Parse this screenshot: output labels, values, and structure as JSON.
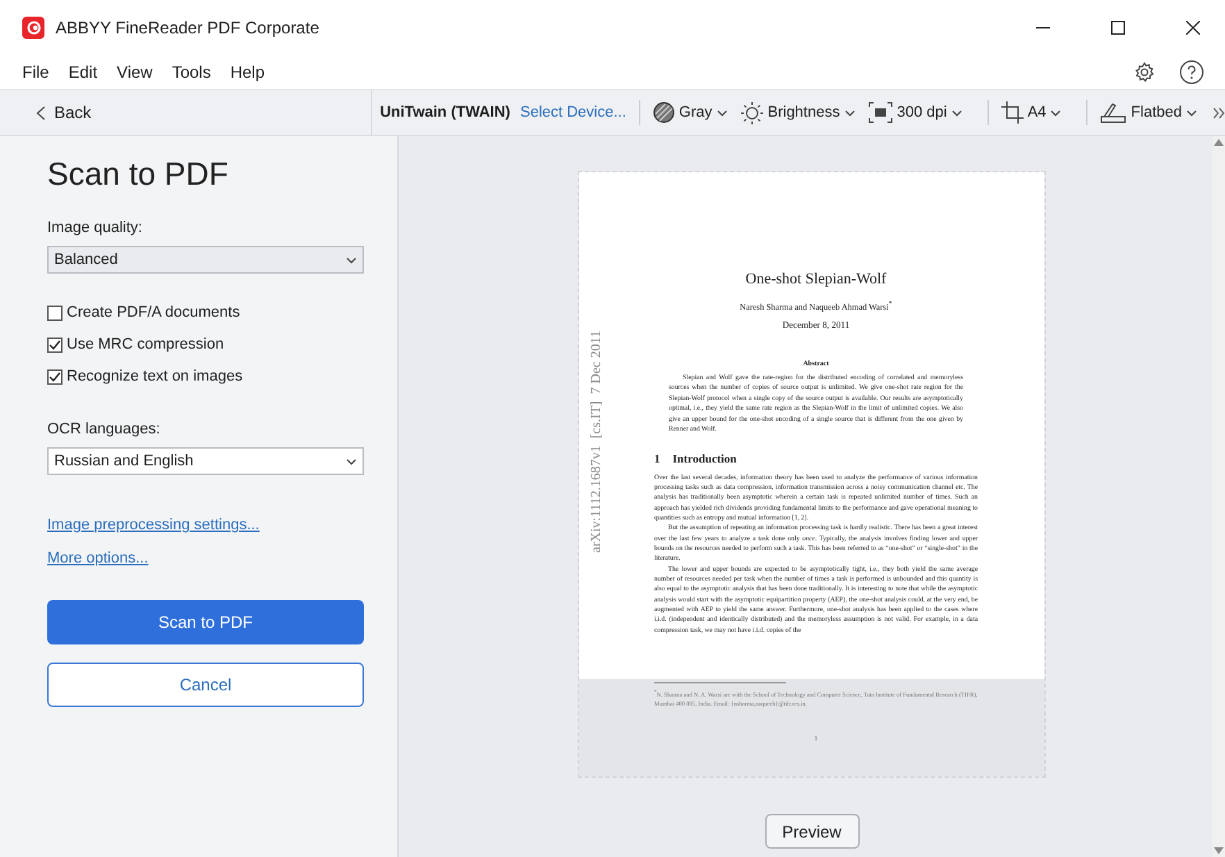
{
  "window": {
    "title": "ABBYY FineReader PDF Corporate"
  },
  "menu": [
    "File",
    "Edit",
    "View",
    "Tools",
    "Help"
  ],
  "back": "Back",
  "toolbar": {
    "device": "UniTwain (TWAIN)",
    "select_device": "Select Device...",
    "items": [
      {
        "kind": "color",
        "label": "Gray"
      },
      {
        "kind": "brightness",
        "label": "Brightness"
      },
      {
        "kind": "resolution",
        "label": "300 dpi"
      },
      {
        "kind": "crop",
        "label": "A4"
      },
      {
        "kind": "source",
        "label": "Flatbed"
      }
    ]
  },
  "panel": {
    "title": "Scan to PDF",
    "image_quality": {
      "label": "Image quality:",
      "value": "Balanced"
    },
    "options": [
      {
        "label": "Create PDF/A documents",
        "checked": false
      },
      {
        "label": "Use MRC compression",
        "checked": true
      },
      {
        "label": "Recognize text on images",
        "checked": true
      }
    ],
    "ocr_languages": {
      "label": "OCR languages:",
      "value": "Russian and English"
    },
    "links": [
      "Image preprocessing settings...",
      "More options..."
    ],
    "primary_button": "Scan to PDF",
    "secondary_button": "Cancel"
  },
  "preview": {
    "side_label": "arXiv:1112.1687v1  [cs.IT]  7 Dec 2011",
    "title": "One-shot Slepian-Wolf",
    "authors": "Naresh Sharma and Naqueeb Ahmad Warsi$^{*}$",
    "date": "December 8, 2011",
    "abstract_heading": "Abstract",
    "abstract": "Slepian and Wolf gave the rate-region for the distributed encoding of correlated and memoryless sources when the number of copies of source output is unlimited. We give one-shot rate region for the Slepian-Wolf protocol when a single copy of the source output is available. Our results are asymptotically optimal, i.e., they yield the same rate region as the Slepian-Wolf in the limit of unlimited copies. We also give an upper bound for the one-shot encoding of a single source that is different from the one given by Renner and Wolf.",
    "section_number": "1",
    "section_title": "Introduction",
    "paragraphs": [
      "Over the last several decades, information theory has been used to analyze the performance of various information processing tasks such as data compression, information transmission across a noisy communication channel etc. The analysis has traditionally been asymptotic wherein a certain task is repeated unlimited number of times. Such an approach has yielded rich dividends providing fundamental limits to the performance and gave operational meaning to quantities such as entropy and mutual information [1, 2].",
      "But the assumption of repeating an information processing task is hardly realistic. There has been a great interest over the last few years to analyze a task done only *once*. Typically, the analysis involves finding lower and upper bounds on the resources needed to perform such a task. This has been referred to as “one-shot” or “single-shot” in the literature.",
      "The lower and upper bounds are expected to be asymptotically tight, i.e., they both yield the same average number of resources needed per task when the number of times a task is performed is unbounded and this quantity is also equal to the asymptotic analysis that has been done traditionally. It is interesting to note that while the asymptotic analysis would start with the asymptotic equipartition property (AEP), the one-shot analysis could, at the very end, be augmented with AEP to yield the same answer. Furthermore, one-shot analysis has been applied to the cases where i.i.d. (independent and identically distributed) and the memoryless assumption is not valid. For example, in a data compression task, we may not have i.i.d. copies of the"
    ],
    "footnote": "$^{*}$N. Sharma and N. A. Warsi are with the School of Technology and Computer Science, Tata Institute of Fundamental Research (TIFR), Mumbai 400 005, India. Email: {nsharma,naqueeb}@tifr.res.in.",
    "page_number": "1",
    "button": "Preview"
  }
}
